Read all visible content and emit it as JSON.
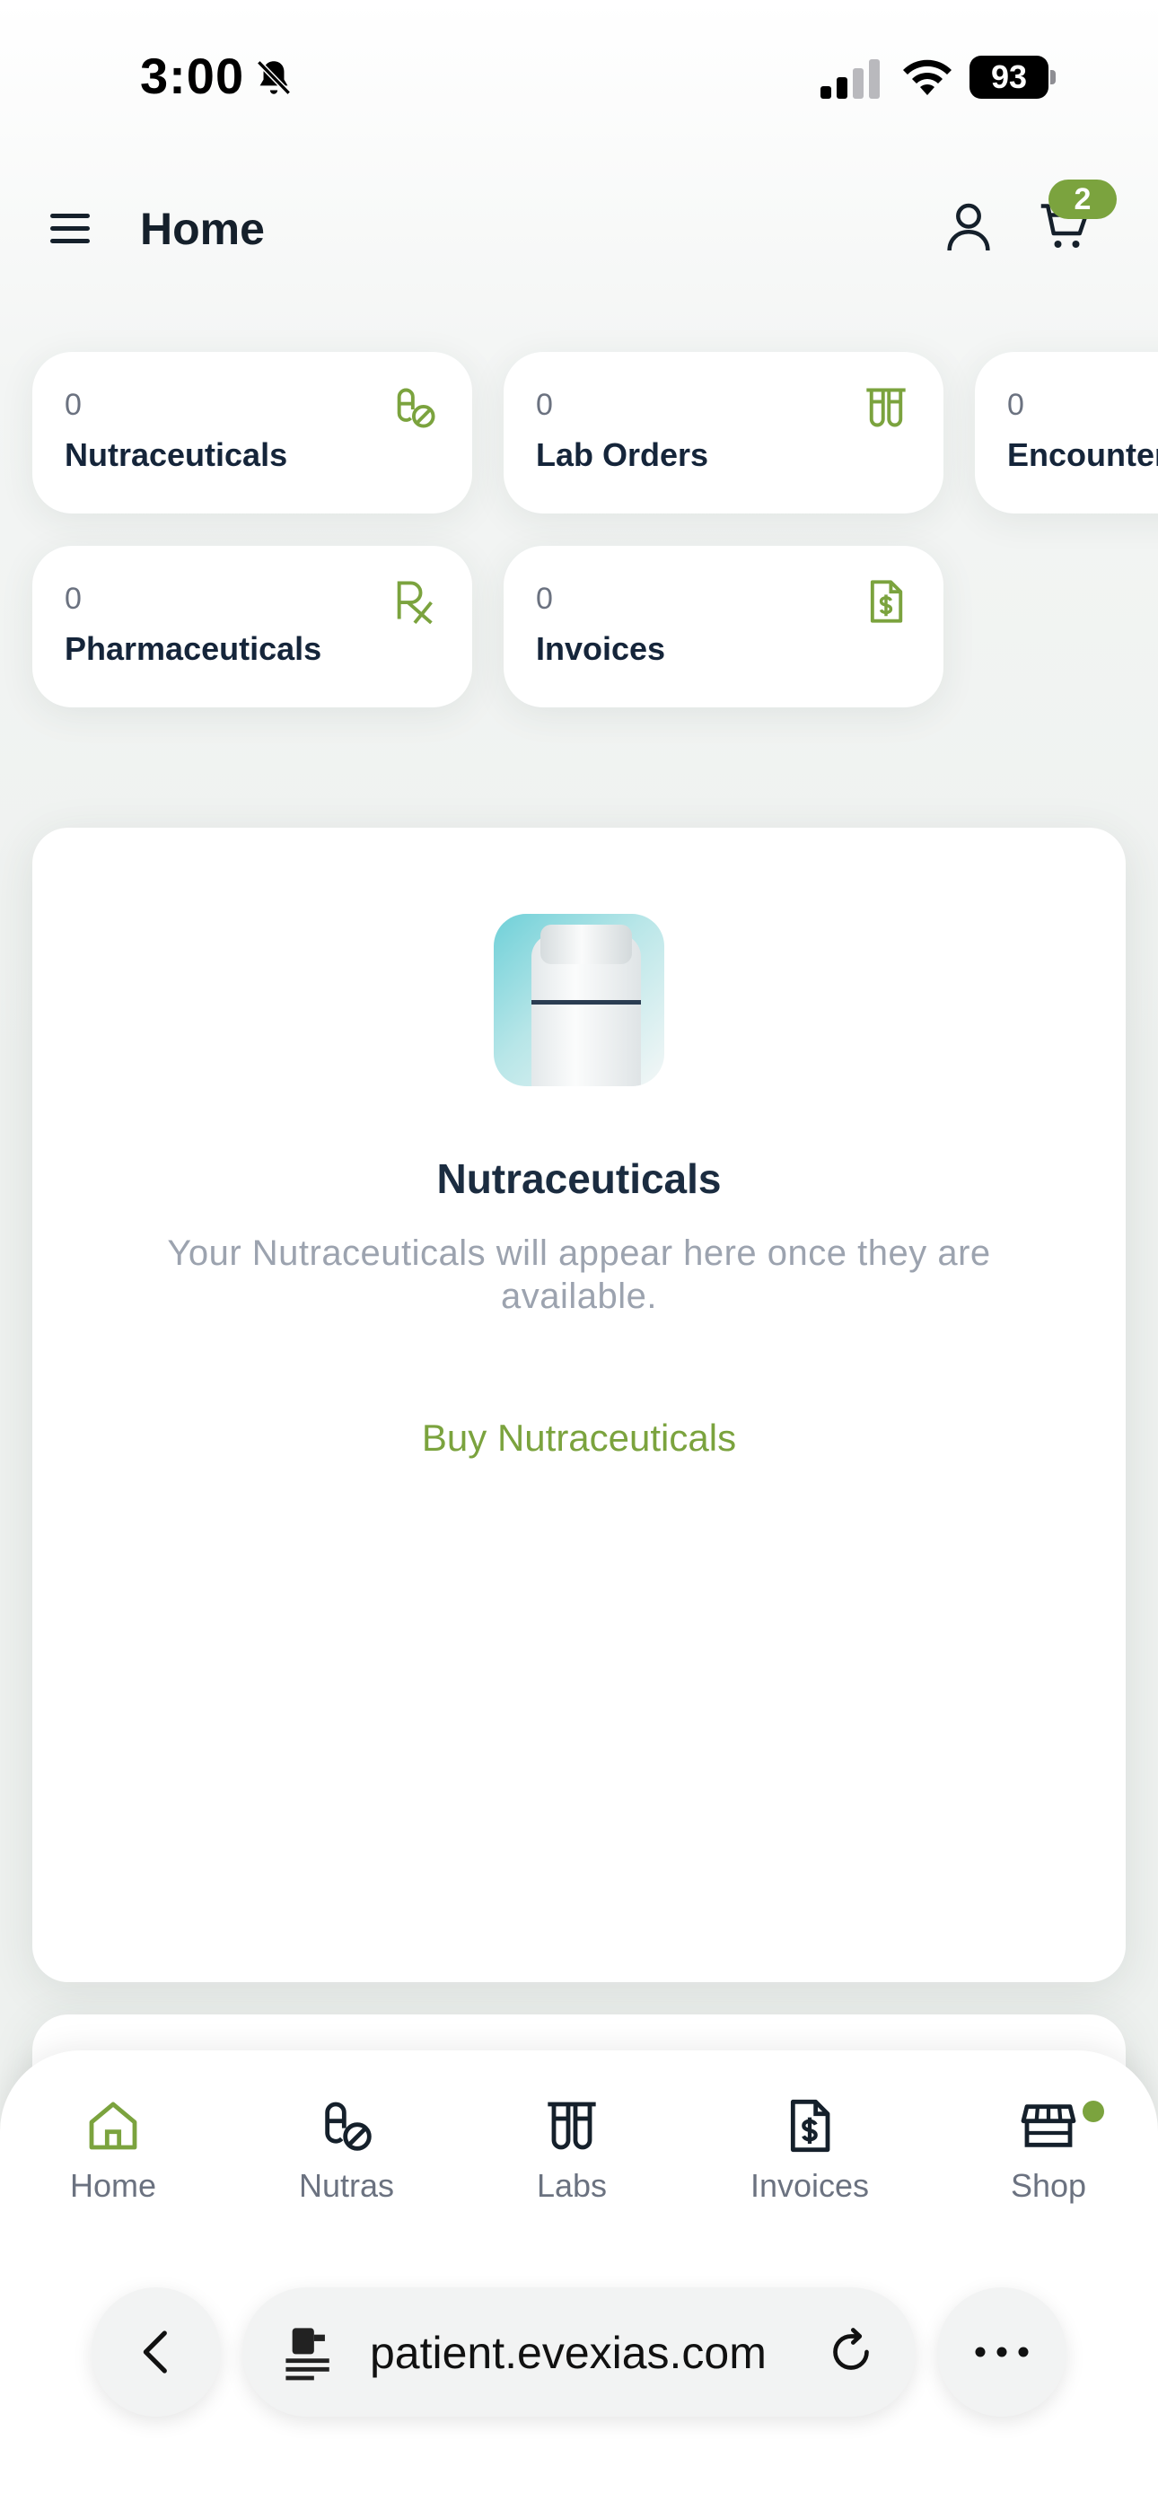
{
  "status_bar": {
    "time": "3:00",
    "battery": "93"
  },
  "header": {
    "title": "Home",
    "cart_count": "2"
  },
  "stat_cards": [
    {
      "count": "0",
      "label": "Nutraceuticals",
      "icon": "pill-icon"
    },
    {
      "count": "0",
      "label": "Lab Orders",
      "icon": "test-tubes-icon"
    },
    {
      "count": "0",
      "label": "Encounters",
      "icon": ""
    },
    {
      "count": "0",
      "label": "Pharmaceuticals",
      "icon": "rx-icon"
    },
    {
      "count": "0",
      "label": "Invoices",
      "icon": "invoice-icon"
    }
  ],
  "empty_state": {
    "title": "Nutraceuticals",
    "description": "Your Nutraceuticals will appear here once they are available.",
    "action": "Buy Nutraceuticals"
  },
  "bottom_nav": [
    {
      "label": "Home",
      "icon": "home-icon"
    },
    {
      "label": "Nutras",
      "icon": "pill-icon"
    },
    {
      "label": "Labs",
      "icon": "test-tubes-icon"
    },
    {
      "label": "Invoices",
      "icon": "invoice-icon"
    },
    {
      "label": "Shop",
      "icon": "store-icon"
    }
  ],
  "browser": {
    "url": "patient.evexias.com"
  },
  "colors": {
    "accent": "#7ba33e",
    "text_dark": "#15253a",
    "muted": "#9ca3af"
  }
}
